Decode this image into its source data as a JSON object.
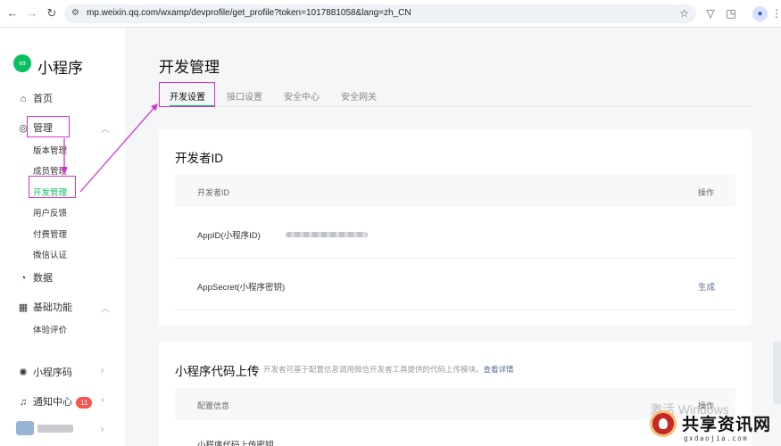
{
  "browser": {
    "url": "mp.weixin.qq.com/wxamp/devprofile/get_profile?token=1017881058&lang=zh_CN"
  },
  "sidebar": {
    "app_name": "小程序",
    "home": "首页",
    "manage": "管理",
    "manage_items": [
      "版本管理",
      "成员管理",
      "开发管理",
      "用户反馈",
      "付费管理",
      "微信认证"
    ],
    "data": "数据",
    "basic": "基础功能",
    "basic_items": [
      "体验评价"
    ],
    "mini_code": "小程序码",
    "notifications": "通知中心",
    "notification_count": "11"
  },
  "main": {
    "page_title": "开发管理",
    "tabs": [
      "开发设置",
      "接口设置",
      "安全中心",
      "安全网关"
    ],
    "developer_card": {
      "title": "开发者ID",
      "col_id": "开发者ID",
      "col_action": "操作",
      "rows": [
        {
          "label": "AppID(小程序ID)",
          "action": ""
        },
        {
          "label": "AppSecret(小程序密钥)",
          "action": "生成"
        }
      ]
    },
    "upload_card": {
      "title": "小程序代码上传",
      "desc": "开发者可基于配置信息调用微信开发者工具提供的代码上传模块。",
      "link": "查看详情",
      "col_config": "配置信息",
      "col_action": "操作",
      "row1_partial": "小程序代码上传密钥"
    }
  },
  "overlay": {
    "windows_watermark": "激活 Windows",
    "brand_name": "共享资讯网",
    "brand_domain": "gxdaojia.com"
  }
}
